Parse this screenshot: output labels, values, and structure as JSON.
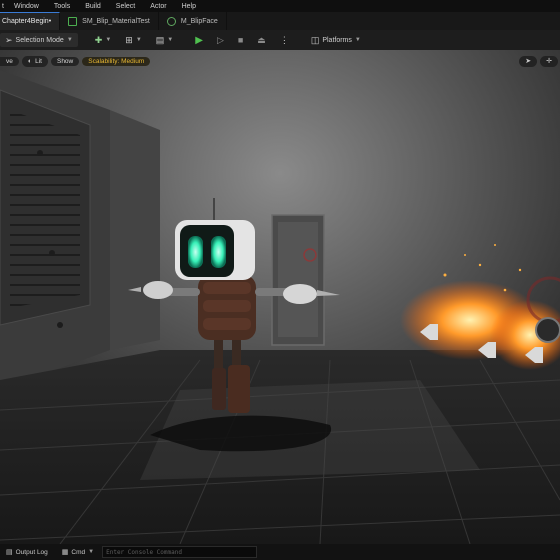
{
  "menu": [
    "Window",
    "Tools",
    "Build",
    "Select",
    "Actor",
    "Help"
  ],
  "tabs": [
    {
      "label": "Chapter4Begin•",
      "active": true
    },
    {
      "label": "SM_Blip_MaterialTest",
      "active": false
    },
    {
      "label": "M_BlipFace",
      "active": false
    }
  ],
  "toolbar": {
    "selection_mode": "Selection Mode",
    "platforms": "Platforms"
  },
  "viewport_bar": {
    "perspective": "ve",
    "lit": "Lit",
    "show": "Show",
    "scalability": "Scalability: Medium"
  },
  "status": {
    "output_log": "Output Log",
    "cmd": "Cmd",
    "console_placeholder": "Enter Console Command"
  },
  "colors": {
    "accent": "#3a7bd5",
    "play": "#4fc04f",
    "warning": "#e7b733",
    "face_glow": "#38f0b8"
  }
}
